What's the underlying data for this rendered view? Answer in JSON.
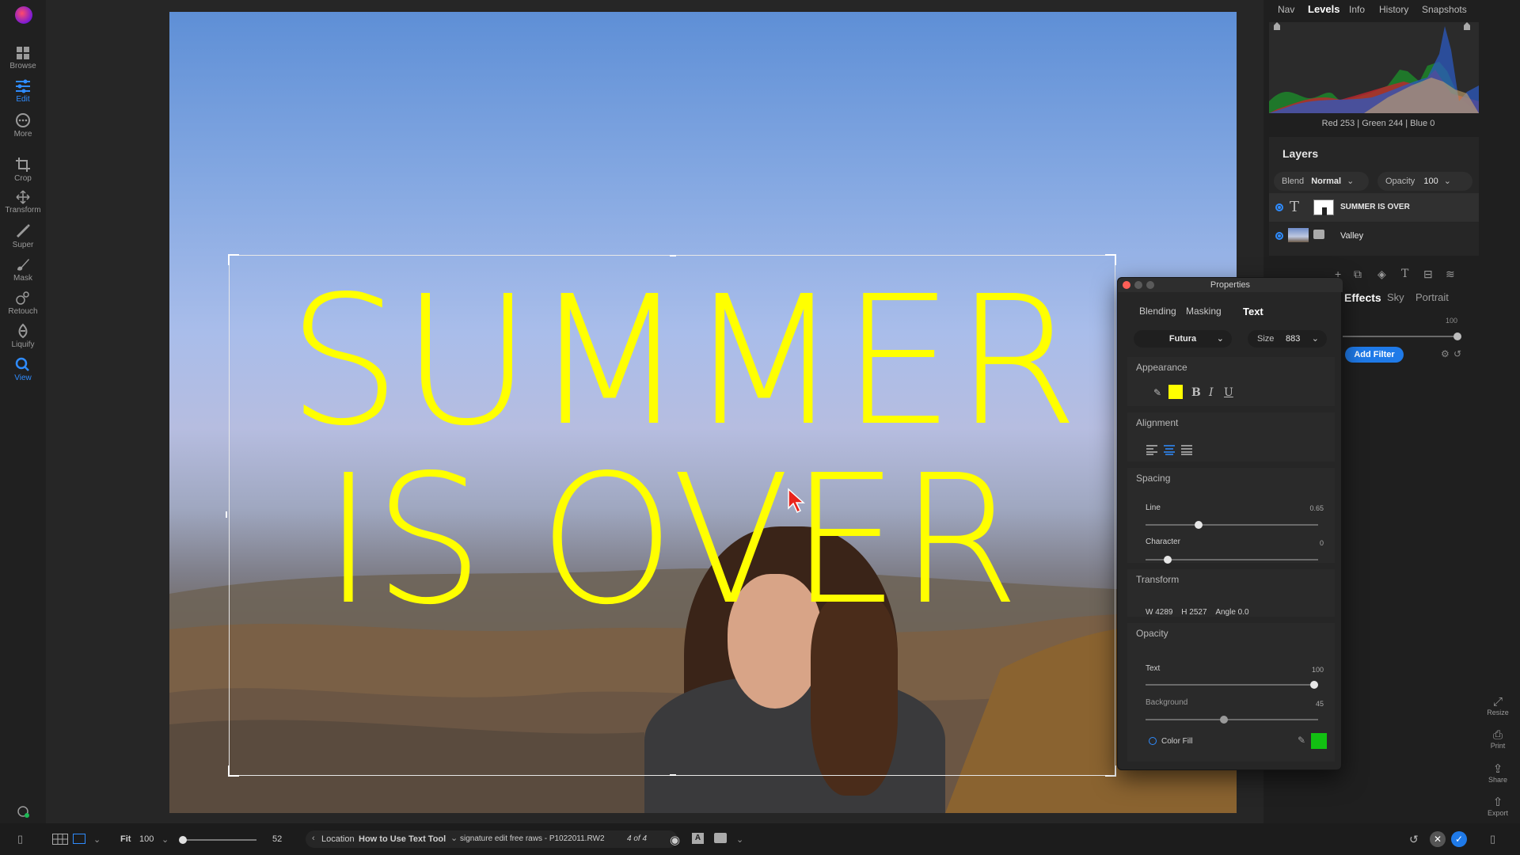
{
  "toolbar": {
    "items": [
      {
        "label": "Browse",
        "icon": "grid-icon"
      },
      {
        "label": "Edit",
        "icon": "sliders-icon"
      },
      {
        "label": "More",
        "icon": "more-icon"
      },
      {
        "label": "Crop",
        "icon": "crop-icon"
      },
      {
        "label": "Transform",
        "icon": "move-icon"
      },
      {
        "label": "Super",
        "icon": "wand-icon"
      },
      {
        "label": "Mask",
        "icon": "brush-icon"
      },
      {
        "label": "Retouch",
        "icon": "retouch-icon"
      },
      {
        "label": "Liquify",
        "icon": "liquify-icon"
      },
      {
        "label": "View",
        "icon": "zoom-icon"
      }
    ]
  },
  "canvas": {
    "overlay_text_line1": "SUMMER",
    "overlay_text_line2": "IS OVER",
    "text_color": "#ffff00"
  },
  "right_panel": {
    "tabs": [
      "Nav",
      "Levels",
      "Info",
      "History",
      "Snapshots"
    ],
    "active_tab": "Levels",
    "rgb_readout": "Red 253 | Green 244 | Blue   0",
    "layers": {
      "title": "Layers",
      "blend_label": "Blend",
      "blend_value": "Normal",
      "opacity_label": "Opacity",
      "opacity_value": "100",
      "rows": [
        {
          "name": "SUMMER IS OVER",
          "type": "text",
          "selected": true
        },
        {
          "name": "Valley",
          "type": "image",
          "selected": false
        }
      ]
    },
    "filter_tabs": [
      "Effects",
      "Sky",
      "Portrait"
    ],
    "filter_value": "100",
    "add_filter_label": "Add Filter",
    "bottom_actions": [
      "Resize",
      "Print",
      "Share",
      "Export"
    ]
  },
  "properties": {
    "title": "Properties",
    "tabs": [
      "Blending",
      "Masking",
      "Text"
    ],
    "active_tab": "Text",
    "font": "Futura",
    "size_label": "Size",
    "size_value": "883",
    "appearance_title": "Appearance",
    "text_color": "#ffff00",
    "alignment_title": "Alignment",
    "alignment_value": "center",
    "spacing_title": "Spacing",
    "line_label": "Line",
    "line_value": "0.65",
    "line_fraction": 0.3,
    "character_label": "Character",
    "character_value": "0",
    "character_fraction": 0.11,
    "transform_title": "Transform",
    "w_label": "W",
    "w_value": "4289",
    "h_label": "H",
    "h_value": "2527",
    "angle_label": "Angle",
    "angle_value": "0.0",
    "opacity_title": "Opacity",
    "text_opacity_label": "Text",
    "text_opacity_value": "100",
    "text_opacity_fraction": 1.0,
    "background_label": "Background",
    "background_value": "45",
    "background_fraction": 0.45,
    "color_fill_label": "Color Fill",
    "color_fill_swatch": "#12c012"
  },
  "bottombar": {
    "fit_label": "Fit",
    "zoom_value": "100",
    "slider_value": "52",
    "location_label": "Location",
    "location_folder": "How to Use Text Tool",
    "location_file": "signature edit free raws - P1022011.RW2",
    "position": "4 of 4"
  }
}
